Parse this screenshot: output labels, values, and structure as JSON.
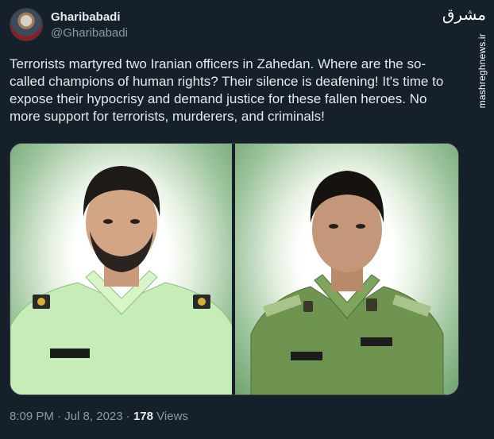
{
  "author": {
    "display_name": "Gharibabadi",
    "handle": "@Gharibabadi"
  },
  "tweet": {
    "text": "Terrorists martyred two Iranian officers in Zahedan. Where are the so-called champions of human rights? Their silence is deafening! It's time to expose their hypocrisy and demand justice for these fallen heroes. No more support for terrorists, murderers, and criminals!"
  },
  "watermark": {
    "logo": "مشرق",
    "site": "mashreghnews.ir"
  },
  "media": {
    "photos": [
      {
        "name": "officer-left",
        "uniform": "light-green"
      },
      {
        "name": "officer-right",
        "uniform": "olive-green"
      }
    ]
  },
  "meta": {
    "time": "8:09 PM",
    "separator": "·",
    "date": "Jul 8, 2023",
    "views_count": "178",
    "views_label": "Views"
  }
}
